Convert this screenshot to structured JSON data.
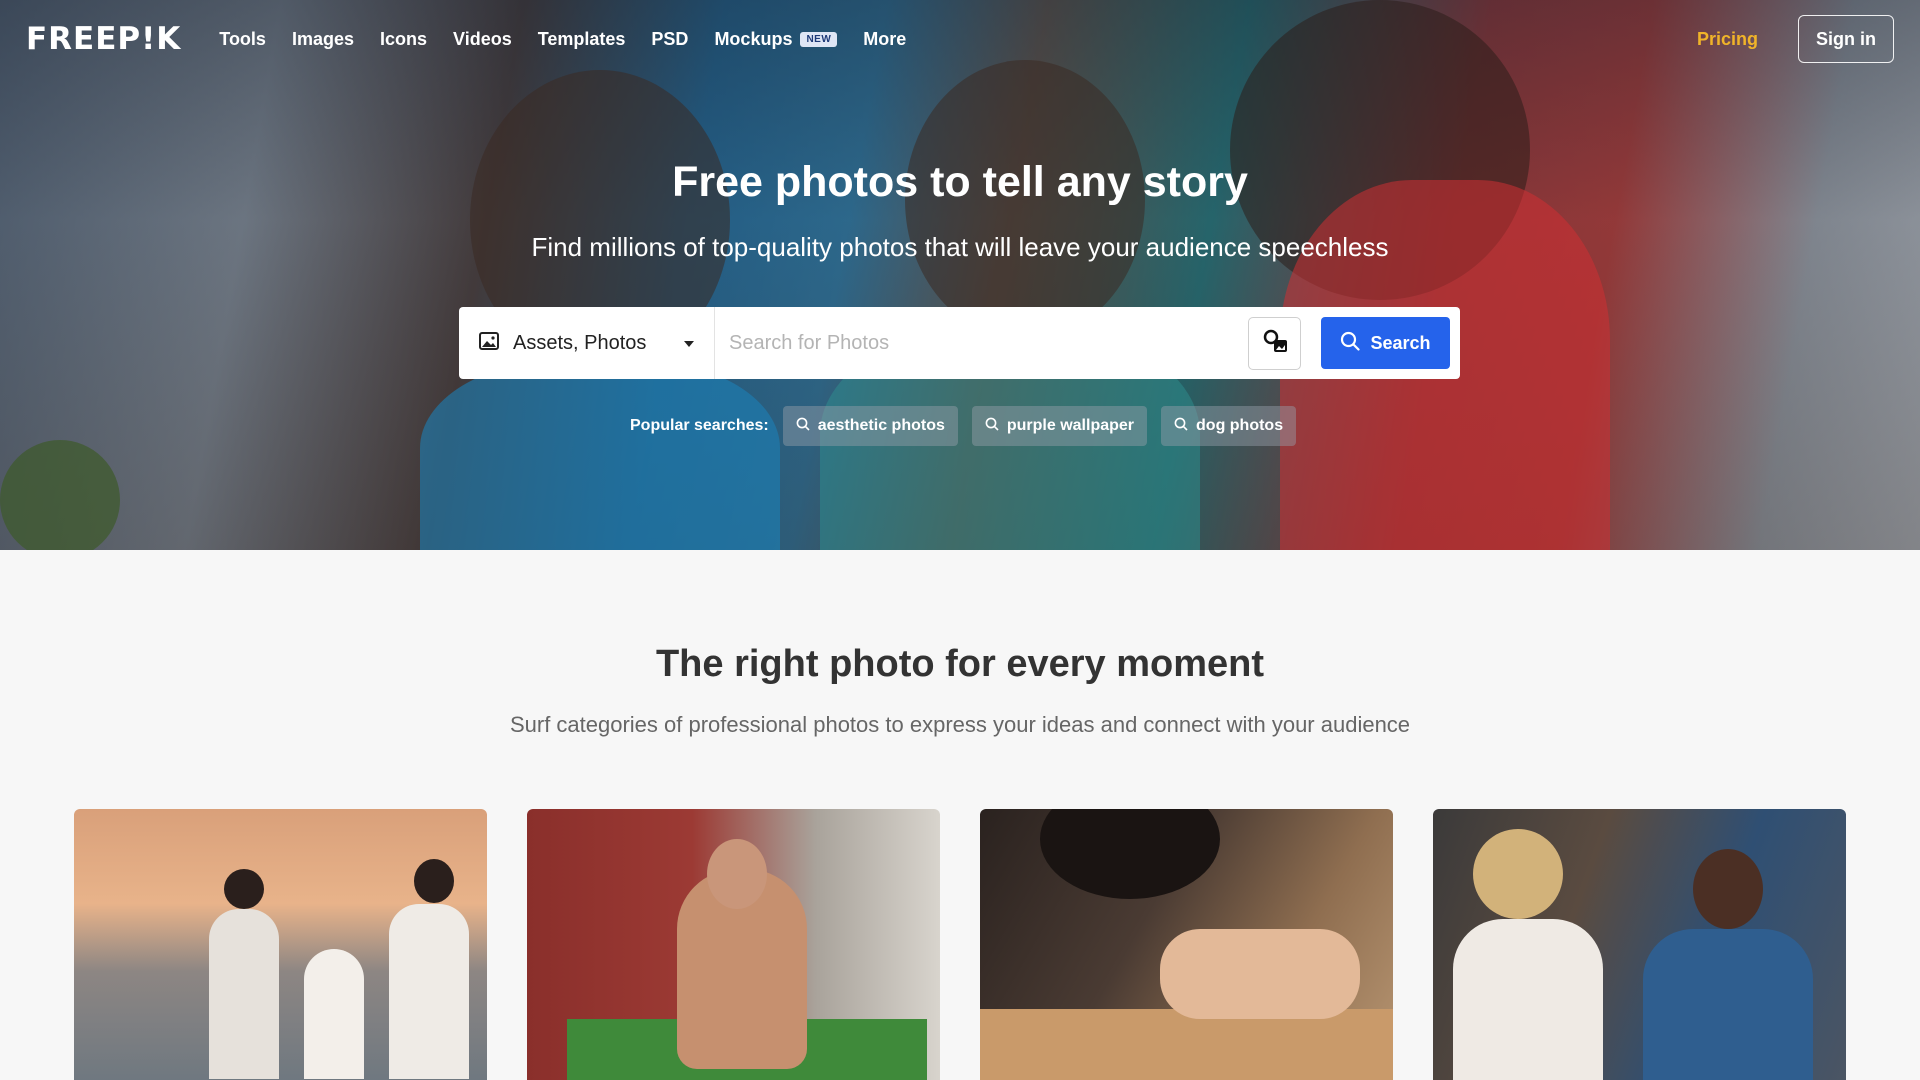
{
  "nav": {
    "logo": "FREEP!K",
    "links": [
      "Tools",
      "Images",
      "Icons",
      "Videos",
      "Templates",
      "PSD",
      "Mockups",
      "More"
    ],
    "mockups_badge": "NEW",
    "pricing": "Pricing",
    "signin": "Sign in"
  },
  "hero": {
    "title": "Free photos to tell any story",
    "subtitle": "Find millions of top-quality photos that will leave your audience speechless"
  },
  "search": {
    "type_label": "Assets, Photos",
    "placeholder": "Search for Photos",
    "button_label": "Search"
  },
  "popular": {
    "label": "Popular searches:",
    "chips": [
      "aesthetic photos",
      "purple wallpaper",
      "dog photos"
    ]
  },
  "section": {
    "title": "The right photo for every moment",
    "subtitle": "Surf categories of professional photos to express your ideas and connect with your audience"
  },
  "colors": {
    "accent": "#2563eb",
    "pricing": "#f0b429",
    "background": "#f7f7f7"
  }
}
